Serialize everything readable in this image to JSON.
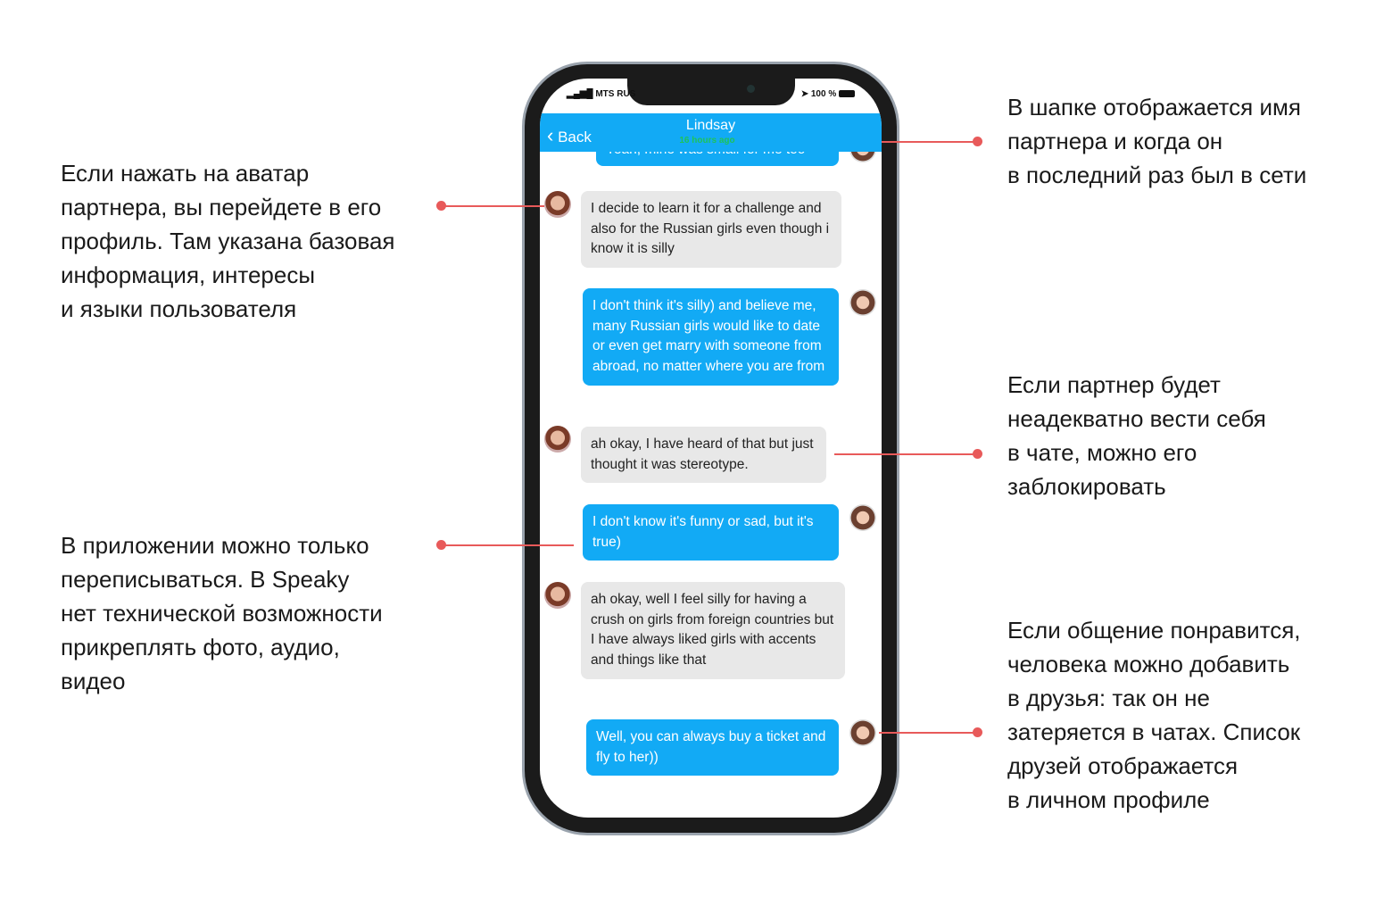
{
  "annotations": {
    "avatar": "Если нажать на аватар\nпартнера, вы перейдете в его\nпрофиль. Там указана базовая\nинформация, интересы\nи языки пользователя",
    "text_only": "В приложении можно только\nпереписываться. В Speaky\nнет технической возможности\nприкреплять фото, аудио,\nвидео",
    "header": "В шапке отображается имя\nпартнера и когда он\nв последний раз был в сети",
    "block": "Если партнер будет\nнеадекватно вести себя\nв чате, можно его\nзаблокировать",
    "friends": "Если общение понравится,\nчеловека можно добавить\nв друзья: так он не\nзатеряется в чатах. Список\nдрузей отображается\nв личном профиле"
  },
  "status": {
    "carrier": "MTS RUS",
    "battery": "100 %"
  },
  "header": {
    "back": "Back",
    "name": "Lindsay",
    "last_seen": "16 hours ago"
  },
  "colors": {
    "accent": "#12aaf5",
    "online": "#1fc35a",
    "annotation_line": "#e85a5a"
  },
  "messages": [
    {
      "from": "me",
      "text": "Yeah, mine was small for me too"
    },
    {
      "from": "partner",
      "text": "I decide to learn it for a challenge and also for the Russian girls even though i know it is silly"
    },
    {
      "from": "me",
      "text": "I don't think it's silly) and believe me, many Russian girls would like to date or even get marry with someone from abroad, no matter where you are from"
    },
    {
      "from": "partner",
      "text": "ah okay, I have heard of that but just thought it was stereotype."
    },
    {
      "from": "me",
      "text": "I don't know it's funny or sad, but it's true)"
    },
    {
      "from": "partner",
      "text": "ah okay, well I feel silly for having a crush on girls from foreign countries but I have always liked girls with accents and things like that"
    },
    {
      "from": "me",
      "text": "Well, you can always buy a ticket and fly to her))"
    }
  ]
}
